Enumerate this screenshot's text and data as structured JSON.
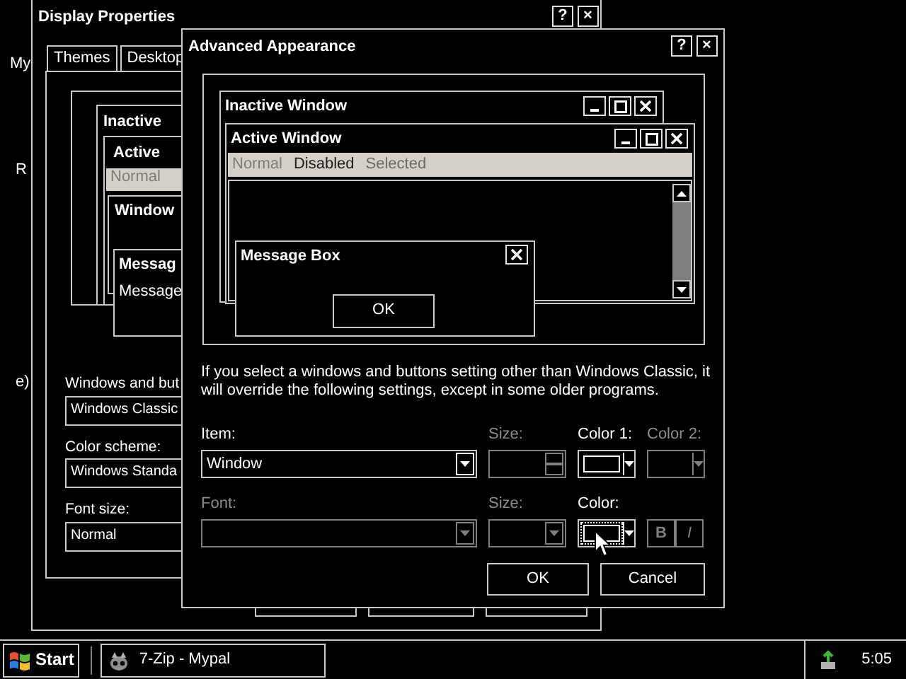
{
  "desktop_icons": [
    {
      "label": "My"
    },
    {
      "label": "R"
    },
    {
      "label": "e)"
    }
  ],
  "display_properties": {
    "title": "Display Properties",
    "title_buttons": [
      "?",
      "×"
    ],
    "tabs": [
      {
        "label": "Themes",
        "selected": false
      },
      {
        "label": "Desktop",
        "selected": false
      }
    ],
    "preview": {
      "inactive_title": "Inactive",
      "active_title": "Active",
      "menu": [
        {
          "label": "Normal",
          "kind": "normal"
        }
      ],
      "pane_title": "Window",
      "message_title": "Messag",
      "message_text": "Message"
    },
    "fields": [
      {
        "label": "Windows and but",
        "value": "Windows Classic"
      },
      {
        "label": "Color scheme:",
        "value": "Windows Standa"
      },
      {
        "label": "Font size:",
        "value": "Normal"
      }
    ]
  },
  "advanced_appearance": {
    "title": "Advanced Appearance",
    "title_buttons": [
      "?",
      "×"
    ],
    "preview": {
      "inactive_title": "Inactive Window",
      "active_title": "Active Window",
      "menu": [
        {
          "label": "Normal",
          "kind": "normal"
        },
        {
          "label": "Disabled",
          "kind": "disabled"
        },
        {
          "label": "Selected",
          "kind": "selected"
        }
      ],
      "message_box": {
        "title": "Message Box",
        "button": "OK"
      }
    },
    "note": "If you select a windows and buttons setting other than Windows Classic, it will override the following settings, except in some older programs.",
    "settings": [
      {
        "kind": "combo",
        "label": "Item:",
        "value": "Window",
        "disabled": false
      },
      {
        "kind": "spin",
        "label": "Size:",
        "disabled": true
      },
      {
        "kind": "color",
        "label": "Color 1:",
        "disabled": false,
        "focused": false
      },
      {
        "kind": "color",
        "label": "Color 2:",
        "disabled": true,
        "focused": false
      },
      {
        "kind": "combo",
        "label": "Font:",
        "disabled": true
      },
      {
        "kind": "combo",
        "label": "Size:",
        "disabled": true
      },
      {
        "kind": "color",
        "label": "Color:",
        "disabled": false,
        "focused": true
      },
      {
        "kind": "style",
        "buttons": [
          "B",
          "I"
        ],
        "disabled": true
      }
    ],
    "buttons": [
      "OK",
      "Cancel"
    ]
  },
  "taskbar": {
    "start": "Start",
    "tasks": [
      {
        "label": "7-Zip - Mypal"
      }
    ],
    "clock": "5:05"
  }
}
